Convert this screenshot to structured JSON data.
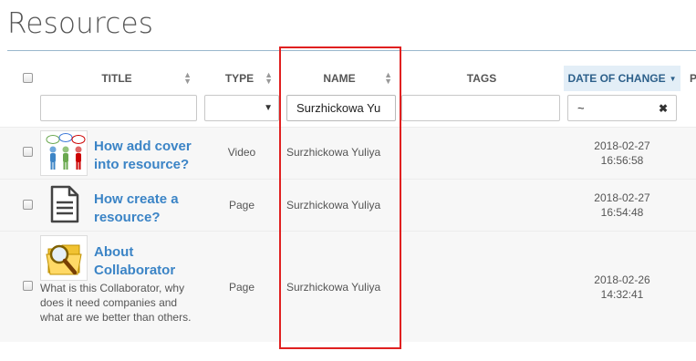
{
  "page": {
    "title": "Resources"
  },
  "columns": {
    "title": "TITLE",
    "type": "TYPE",
    "name": "NAME",
    "tags": "TAGS",
    "date": "DATE OF CHANGE",
    "next": "P"
  },
  "filters": {
    "title_value": "",
    "type_value": "",
    "name_value": "Surzhickowa Yu",
    "tags_value": "",
    "date_value": "~"
  },
  "rows": [
    {
      "title_line1": "How add cover",
      "title_line2": "into resource?",
      "type": "Video",
      "name": "Surzhickowa Yuliya",
      "date": "2018-02-27",
      "time": "16:56:58"
    },
    {
      "title_line1": "How create a",
      "title_line2": "resource?",
      "type": "Page",
      "name": "Surzhickowa Yuliya",
      "date": "2018-02-27",
      "time": "16:54:48"
    },
    {
      "title_line1": "About",
      "title_line2": "Collaborator",
      "description": "What is this Collaborator, why does it need companies and what are we better than others.",
      "type": "Page",
      "name": "Surzhickowa Yuliya",
      "date": "2018-02-26",
      "time": "14:32:41"
    }
  ],
  "icons": [
    "people-chat-icon",
    "document-icon",
    "folder-magnifier-icon",
    "sort-icon",
    "sort-desc-icon",
    "dropdown-arrow-icon",
    "clear-icon"
  ],
  "colors": {
    "link": "#3b84c6",
    "active_header": "#e3eef7",
    "highlight_box": "#e02020"
  }
}
